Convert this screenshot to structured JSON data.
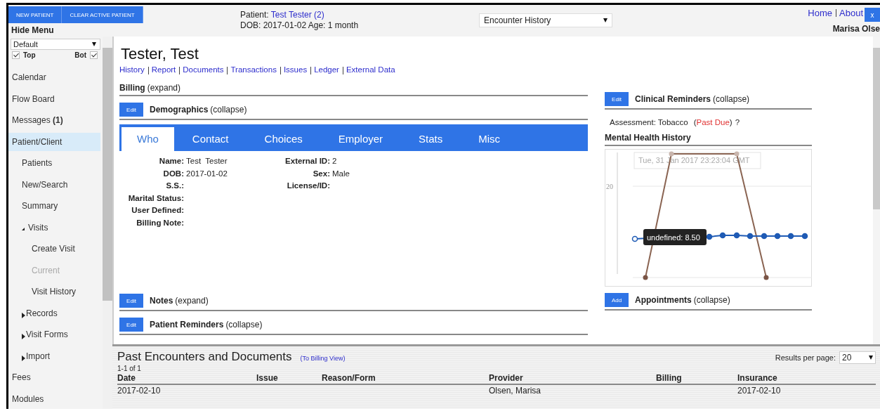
{
  "header": {
    "buttons": [
      "NEW PATIENT",
      "CLEAR ACTIVE PATIENT"
    ],
    "hide_menu": "Hide Menu",
    "patient_label": "Patient:",
    "patient_name": "Test Tester (2)",
    "dob_line": "DOB: 2017-01-02 Age: 1 month",
    "view_select": "Encounter History",
    "links": [
      "Home",
      "About"
    ],
    "close": "x",
    "user": "Marisa Olse"
  },
  "sidebar": {
    "layout_select": "Default",
    "checks": [
      {
        "label": "Top",
        "checked": true
      },
      {
        "label": "Bot",
        "checked": true
      }
    ],
    "items": [
      {
        "label": "Calendar",
        "selected": false
      },
      {
        "label": "Flow Board",
        "selected": false
      },
      {
        "label": "Messages **(1)**",
        "selected": false
      },
      {
        "label": "Patient/Client",
        "selected": true,
        "children": [
          {
            "label": "Patients",
            "selected": false
          },
          {
            "label": "New/Search",
            "selected": false
          },
          {
            "label": "Summary",
            "selected": false
          },
          {
            "label": "Visits",
            "selected": false,
            "expanded": true,
            "children": [
              {
                "label": "Create Visit",
                "selected": false,
                "disabled": false
              },
              {
                "label": "Current",
                "selected": false,
                "disabled": true
              },
              {
                "label": "Visit History",
                "selected": false,
                "disabled": false
              }
            ]
          },
          {
            "label": "Records",
            "selected": false,
            "expanded": false
          },
          {
            "label": "Visit Forms",
            "selected": false,
            "expanded": false
          },
          {
            "label": "Import",
            "selected": false,
            "expanded": false
          }
        ]
      },
      {
        "label": "Fees",
        "selected": false
      },
      {
        "label": "Modules",
        "selected": false
      }
    ]
  },
  "patient": {
    "name": "Tester, Test",
    "links": [
      "History",
      "Report",
      "Documents",
      "Transactions",
      "Issues",
      "Ledger",
      "External Data"
    ]
  },
  "billing": {
    "title": "Billing",
    "toggle": "(expand)"
  },
  "demographics": {
    "button": "Edit",
    "title": "Demographics",
    "toggle": "(collapse)",
    "tabs": [
      {
        "label": "Who",
        "selected": true
      },
      {
        "label": "Contact",
        "selected": false
      },
      {
        "label": "Choices",
        "selected": false
      },
      {
        "label": "Employer",
        "selected": false
      },
      {
        "label": "Stats",
        "selected": false
      },
      {
        "label": "Misc",
        "selected": false
      }
    ],
    "fields_left": [
      {
        "label": "Name:",
        "value": "Test  Tester"
      },
      {
        "label": "DOB:",
        "value": "2017-01-02"
      },
      {
        "label": "S.S.:"
      },
      {
        "label": "Marital Status:"
      },
      {
        "label": "User Defined:"
      },
      {
        "label": "Billing Note:"
      }
    ],
    "fields_right": [
      {
        "label": "External ID:",
        "value": "2"
      },
      {
        "label": "Sex:",
        "value": "Male"
      },
      {
        "label": "License/ID:"
      }
    ]
  },
  "notes": {
    "button": "Edit",
    "title": "Notes",
    "toggle": "(expand)"
  },
  "patient_reminders": {
    "button": "Edit",
    "title": "Patient Reminders",
    "toggle": "(collapse)"
  },
  "clinical_reminders": {
    "button": "Edit",
    "title": "Clinical Reminders",
    "toggle": "(collapse)",
    "item": "Assessment: Tobacco",
    "status_open": "(",
    "status": "Past Due",
    "status_close": ")",
    "help": "?"
  },
  "mental_health": {
    "title": "Mental Health History",
    "y_tick": "20",
    "date_tooltip": "Tue, 31 Jan 2017 23:23:04 GMT",
    "value_tooltip": "undefined: 8.50"
  },
  "appointments": {
    "button": "Add",
    "title": "Appointments",
    "toggle": "(collapse)"
  },
  "encounters": {
    "title": "Past Encounters and Documents",
    "billing_link": "(To Billing View)",
    "count": "1-1 of 1",
    "per_page_label": "Results per page:",
    "per_page": "20",
    "columns": [
      "Date",
      "Issue",
      "Reason/Form",
      "Provider",
      "Billing",
      "Insurance"
    ],
    "rows": [
      [
        "2017-02-10",
        "",
        "",
        "Olsen, Marisa",
        "",
        "2017-02-10"
      ]
    ]
  }
}
